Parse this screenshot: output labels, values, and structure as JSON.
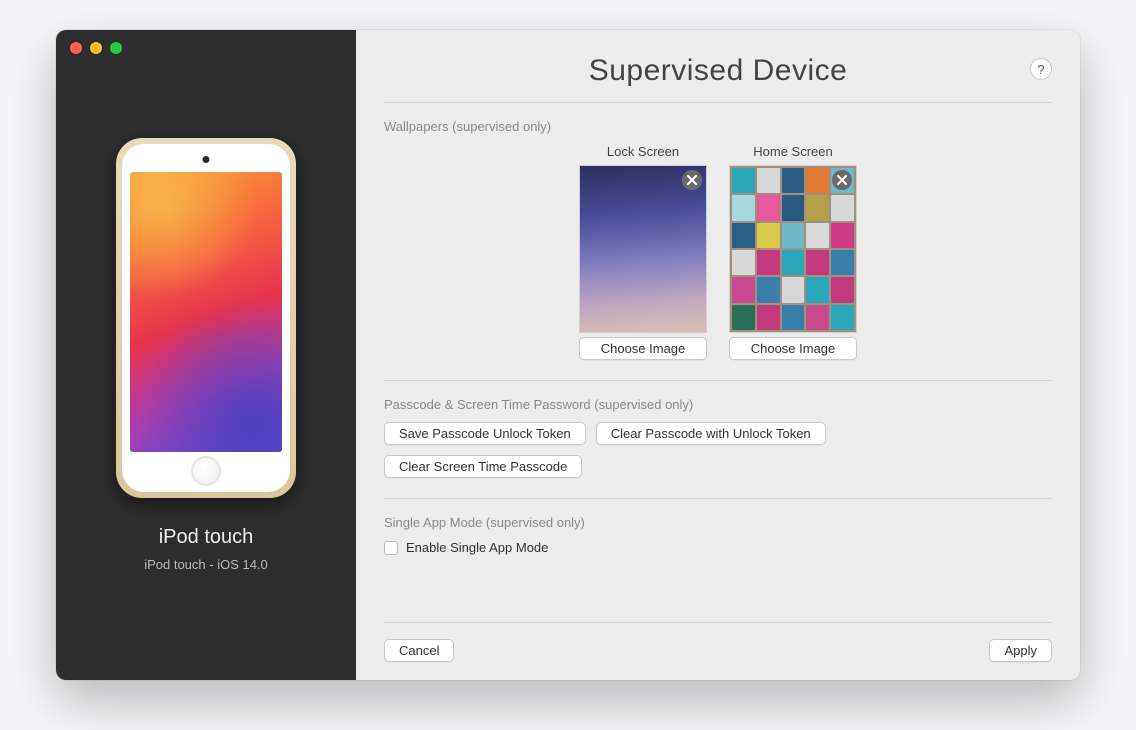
{
  "sidebar": {
    "device_name": "iPod touch",
    "device_subtitle": "iPod touch - iOS 14.0"
  },
  "header": {
    "title": "Supervised Device",
    "help_label": "?"
  },
  "wallpapers": {
    "section_label": "Wallpapers (supervised only)",
    "lock": {
      "title": "Lock Screen",
      "choose_label": "Choose Image"
    },
    "home": {
      "title": "Home Screen",
      "choose_label": "Choose Image"
    }
  },
  "passcode": {
    "section_label": "Passcode & Screen Time Password (supervised only)",
    "save_token_label": "Save Passcode Unlock Token",
    "clear_token_label": "Clear Passcode with Unlock Token",
    "clear_screentime_label": "Clear Screen Time Passcode"
  },
  "single_app": {
    "section_label": "Single App Mode (supervised only)",
    "checkbox_label": "Enable Single App Mode",
    "checked": false
  },
  "footer": {
    "cancel_label": "Cancel",
    "apply_label": "Apply"
  },
  "tile_colors": [
    "#2aa7b8",
    "#d7d7d7",
    "#2c5e84",
    "#e07a34",
    "#6fb8c9",
    "#a7d8df",
    "#e65a9d",
    "#285a82",
    "#b5a04a",
    "#d7d7d7",
    "#2a5f86",
    "#d9c948",
    "#6fb8c9",
    "#d9d9d9",
    "#cf3a86",
    "#d7d7d7",
    "#c43a7f",
    "#2aa7b8",
    "#c43a7f",
    "#3a7fab",
    "#c94a8e",
    "#3a7fab",
    "#d7d7d7",
    "#2aa7b8",
    "#c43a7f",
    "#2a6f5a",
    "#c43a7f",
    "#3a7fab",
    "#c94a8e",
    "#2aa7b8"
  ]
}
